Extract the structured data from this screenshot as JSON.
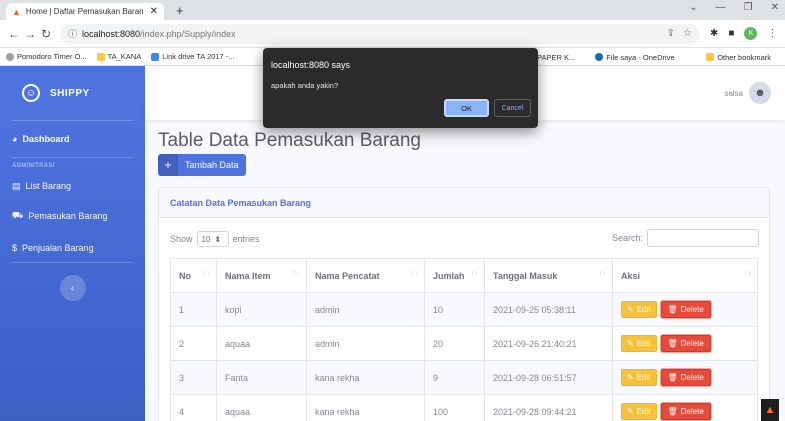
{
  "browser": {
    "tab_title": "Home | Daftar Pemasukan Baran",
    "url_host": "localhost:8080",
    "url_path": "/index.php/Supply/index",
    "bookmarks": [
      {
        "label": "Pomodoro Timer O...",
        "color": "#9aa0a6"
      },
      {
        "label": "TA_KANA",
        "color": "#f9c846"
      },
      {
        "label": "Link drive TA 2017 -...",
        "color": "#4285f4"
      }
    ],
    "bookmarks_right": [
      {
        "label": "PAPER K...",
        "color": "#9aa0a6"
      },
      {
        "label": "File saya - OneDrive",
        "color": "#0f6cbd"
      }
    ],
    "other_bookmarks": "Other bookmark",
    "profile_initial": "K"
  },
  "sidebar": {
    "brand": "SHIPPY",
    "dashboard": "Dashboard",
    "heading": "ADMINITRASI",
    "items": [
      {
        "label": "List Barang",
        "icon": "list-icon"
      },
      {
        "label": "Pemasukan Barang",
        "icon": "truck-icon"
      },
      {
        "label": "Penjualan Barang",
        "icon": "dollar-icon"
      }
    ],
    "accent": "#4e73df"
  },
  "topbar": {
    "username": "salsa"
  },
  "main": {
    "title": "Table Data Pemasukan Barang",
    "add_button": "Tambah Data",
    "card_title": "Catatan Data Pemasukan Barang",
    "show_label": "Show",
    "entries_value": "10",
    "entries_label": "entries",
    "search_label": "Search:",
    "columns": [
      "No",
      "Nama Item",
      "Nama Pencatat",
      "Jumlah",
      "Tanggal Masuk",
      "Aksi"
    ],
    "rows": [
      {
        "no": "1",
        "item": "kopi",
        "pencatat": "admin",
        "jumlah": "10",
        "tanggal": "2021-09-25 05:38:11"
      },
      {
        "no": "2",
        "item": "aquaa",
        "pencatat": "admin",
        "jumlah": "20",
        "tanggal": "2021-09-26 21:40:21"
      },
      {
        "no": "3",
        "item": "Fanta",
        "pencatat": "kana rekha",
        "jumlah": "9",
        "tanggal": "2021-09-28 06:51:57"
      },
      {
        "no": "4",
        "item": "aquaa",
        "pencatat": "kana rekha",
        "jumlah": "100",
        "tanggal": "2021-09-28 09:44:21"
      }
    ],
    "edit_label": "Edit",
    "delete_label": "Delete"
  },
  "dialog": {
    "title": "localhost:8080 says",
    "message": "apakah anda yakin?",
    "ok": "OK",
    "cancel": "Cancel"
  }
}
